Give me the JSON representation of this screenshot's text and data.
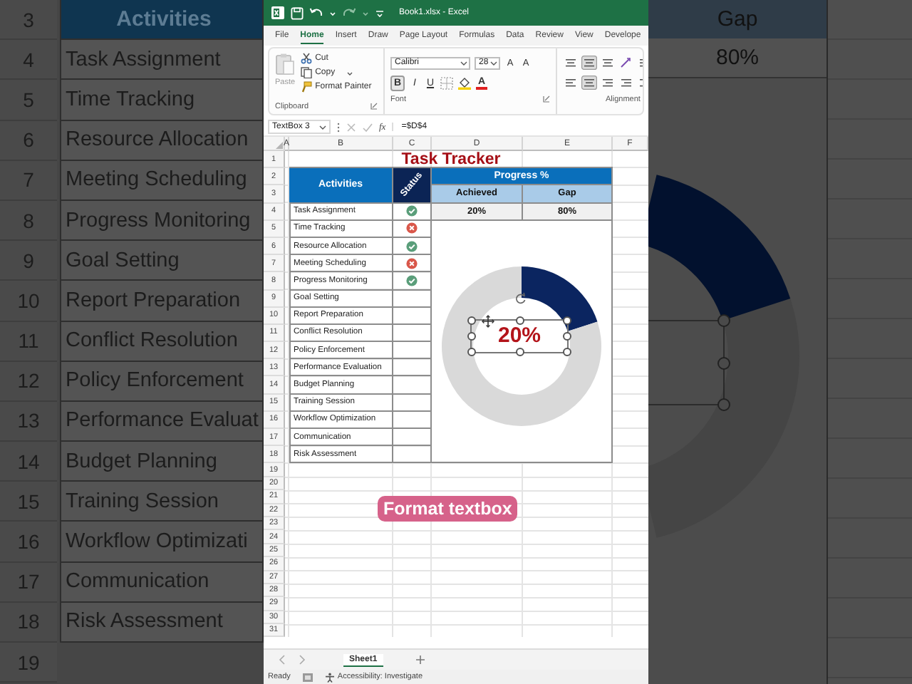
{
  "background_left": {
    "header": "Activities",
    "row_numbers": [
      "3",
      "4",
      "5",
      "6",
      "7",
      "8",
      "9",
      "10",
      "11",
      "12",
      "13",
      "14",
      "15",
      "16",
      "17",
      "18",
      "19"
    ],
    "activities": [
      "Task Assignment",
      "Time Tracking",
      "Resource Allocation",
      "Meeting Scheduling",
      "Progress Monitoring",
      "Goal Setting",
      "Report Preparation",
      "Conflict Resolution",
      "Policy Enforcement",
      "Performance Evaluat",
      "Budget Planning",
      "Training Session",
      "Workflow Optimizati",
      "Communication",
      "Risk Assessment"
    ]
  },
  "background_right": {
    "header": "Gap",
    "value": "80%"
  },
  "window": {
    "title": "Book1.xlsx - Excel"
  },
  "menu_tabs": [
    {
      "label": "File",
      "selected": false
    },
    {
      "label": "Home",
      "selected": true
    },
    {
      "label": "Insert",
      "selected": false
    },
    {
      "label": "Draw",
      "selected": false
    },
    {
      "label": "Page Layout",
      "selected": false
    },
    {
      "label": "Formulas",
      "selected": false
    },
    {
      "label": "Data",
      "selected": false
    },
    {
      "label": "Review",
      "selected": false
    },
    {
      "label": "View",
      "selected": false
    },
    {
      "label": "Develope",
      "selected": false
    }
  ],
  "ribbon": {
    "clipboard": {
      "paste": "Paste",
      "cut": "Cut",
      "copy": "Copy",
      "format_painter": "Format Painter",
      "label": "Clipboard"
    },
    "font": {
      "name": "Calibri",
      "size": "28",
      "grow": "A",
      "shrink": "A",
      "bold": "B",
      "italic": "I",
      "underline": "U",
      "font_color": "A",
      "label": "Font"
    },
    "alignment": {
      "label": "Alignment"
    }
  },
  "formula_bar": {
    "name_box": "TextBox 3",
    "fx": "fx",
    "formula": "=$D$4"
  },
  "columns": [
    "A",
    "B",
    "C",
    "D",
    "E",
    "F"
  ],
  "row_numbers": [
    "1",
    "2",
    "3",
    "4",
    "5",
    "6",
    "7",
    "8",
    "9",
    "10",
    "11",
    "12",
    "13",
    "14",
    "15",
    "16",
    "17",
    "18",
    "19",
    "20",
    "21",
    "22",
    "23",
    "24",
    "25",
    "26",
    "27",
    "28",
    "29",
    "30",
    "31"
  ],
  "sheet": {
    "title": "Task Tracker",
    "activities_header": "Activities",
    "status_header": "Status",
    "progress_header": "Progress %",
    "achieved_header": "Achieved",
    "gap_header": "Gap",
    "achieved": "20%",
    "gap": "80%",
    "tasks": [
      {
        "name": "Task Assignment",
        "kind": "done"
      },
      {
        "name": "Time Tracking",
        "kind": "failed"
      },
      {
        "name": "Resource Allocation",
        "kind": "done"
      },
      {
        "name": "Meeting Scheduling",
        "kind": "failed"
      },
      {
        "name": "Progress Monitoring",
        "kind": "done"
      },
      {
        "name": "Goal Setting",
        "kind": "blank"
      },
      {
        "name": "Report Preparation",
        "kind": "blank"
      },
      {
        "name": "Conflict Resolution",
        "kind": "blank"
      },
      {
        "name": "Policy Enforcement",
        "kind": "blank"
      },
      {
        "name": "Performance Evaluation",
        "kind": "blank"
      },
      {
        "name": "Budget Planning",
        "kind": "blank"
      },
      {
        "name": "Training Session",
        "kind": "blank"
      },
      {
        "name": "Workflow Optimization",
        "kind": "blank"
      },
      {
        "name": "Communication",
        "kind": "blank"
      },
      {
        "name": "Risk Assessment",
        "kind": "blank"
      }
    ],
    "chart": {
      "chart_data": {
        "type": "donut",
        "values": [
          20,
          80
        ]
      },
      "textbox": {
        "text": "20%",
        "selected": true
      }
    }
  },
  "sheet_tabs": [
    {
      "label": "Sheet1",
      "selected": true
    }
  ],
  "status_bar": {
    "ready": "Ready",
    "accessibility": "Accessibility: Investigate"
  },
  "caption": "Format textbox"
}
